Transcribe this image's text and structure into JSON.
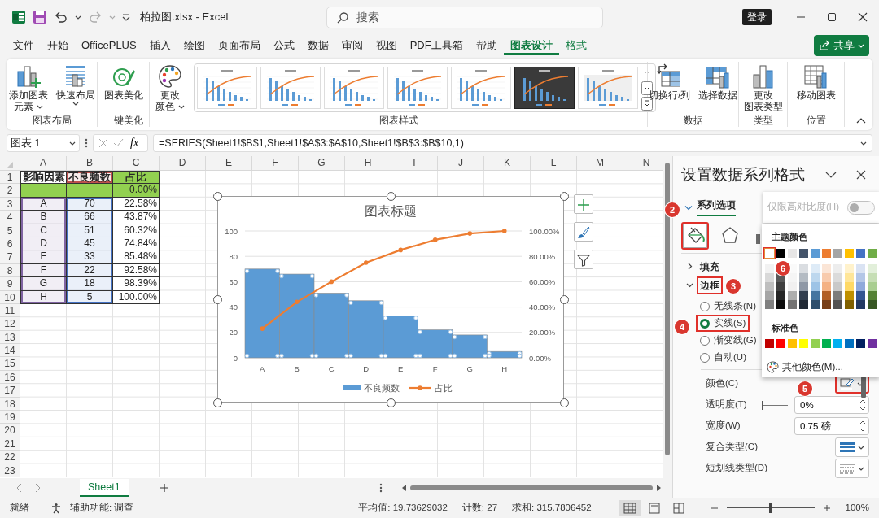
{
  "window": {
    "title": "柏拉图.xlsx  -  Excel"
  },
  "search": {
    "placeholder": "搜索"
  },
  "sign_in": "登录",
  "menu_tabs": [
    {
      "label": "文件",
      "selected": false,
      "kind": "normal"
    },
    {
      "label": "开始",
      "selected": false,
      "kind": "normal"
    },
    {
      "label": "OfficePLUS",
      "selected": false,
      "kind": "normal"
    },
    {
      "label": "插入",
      "selected": false,
      "kind": "normal"
    },
    {
      "label": "绘图",
      "selected": false,
      "kind": "normal"
    },
    {
      "label": "页面布局",
      "selected": false,
      "kind": "normal"
    },
    {
      "label": "公式",
      "selected": false,
      "kind": "normal"
    },
    {
      "label": "数据",
      "selected": false,
      "kind": "normal"
    },
    {
      "label": "审阅",
      "selected": false,
      "kind": "normal"
    },
    {
      "label": "视图",
      "selected": false,
      "kind": "normal"
    },
    {
      "label": "PDF工具箱",
      "selected": false,
      "kind": "normal"
    },
    {
      "label": "帮助",
      "selected": false,
      "kind": "normal"
    },
    {
      "label": "图表设计",
      "selected": true,
      "kind": "contextual"
    },
    {
      "label": "格式",
      "selected": false,
      "kind": "contextual"
    }
  ],
  "share": "共享",
  "ribbon": {
    "groups": [
      {
        "label": "图表布局",
        "commands": [
          {
            "kind": "add-element",
            "lines": [
              "添加图表",
              "元素"
            ],
            "dropdown": true
          },
          {
            "kind": "quick-layout",
            "lines": [
              "快速布局"
            ],
            "dropdown": true
          }
        ]
      },
      {
        "label": "一键美化",
        "commands": [
          {
            "kind": "beautify",
            "lines": [
              "图表美化"
            ],
            "dropdown": false
          }
        ]
      },
      {
        "label": "图表样式",
        "commands": [
          {
            "kind": "colors",
            "lines": [
              "更改",
              "颜色"
            ],
            "dropdown": true
          }
        ],
        "gallery": [
          {
            "kind": "light",
            "selected": false
          },
          {
            "kind": "light",
            "selected": false
          },
          {
            "kind": "light",
            "selected": false
          },
          {
            "kind": "light",
            "selected": false
          },
          {
            "kind": "light",
            "selected": false
          },
          {
            "kind": "dark",
            "selected": false
          },
          {
            "kind": "shaded",
            "selected": false
          }
        ]
      },
      {
        "label": "数据",
        "commands": [
          {
            "kind": "switch",
            "lines": [
              "切换行/列"
            ],
            "dropdown": false
          },
          {
            "kind": "select-data",
            "lines": [
              "选择数据"
            ],
            "dropdown": false
          }
        ]
      },
      {
        "label": "类型",
        "commands": [
          {
            "kind": "chart-type",
            "lines": [
              "更改",
              "图表类型"
            ],
            "dropdown": false
          }
        ]
      },
      {
        "label": "位置",
        "commands": [
          {
            "kind": "move",
            "lines": [
              "移动图表"
            ],
            "dropdown": false
          }
        ]
      }
    ]
  },
  "formula_bar": {
    "name_box": "图表 1",
    "fx": "fx",
    "formula": "=SERIES(Sheet1!$B$1,Sheet1!$A$3:$A$10,Sheet1!$B$3:$B$10,1)"
  },
  "sheet": {
    "columns": [
      "A",
      "B",
      "C",
      "D",
      "E",
      "F",
      "G",
      "H",
      "I",
      "J",
      "K",
      "L",
      "M",
      "N"
    ],
    "rows": [
      "1",
      "2",
      "3",
      "4",
      "5",
      "6",
      "7",
      "8",
      "9",
      "10",
      "11",
      "12",
      "13",
      "14",
      "15",
      "16",
      "17",
      "18",
      "19",
      "20",
      "21",
      "22",
      "23"
    ],
    "cells": [
      [
        {
          "text": "影响因素",
          "kind": "header"
        },
        {
          "text": "不良频数",
          "kind": "header",
          "highlight": {
            "color": "#c0504d"
          }
        },
        {
          "text": "占比",
          "kind": "header",
          "fill": {
            "color": "#92d050"
          }
        }
      ],
      [
        {
          "kind": "data",
          "fill": {
            "color": "#92d050"
          }
        },
        {
          "kind": "data",
          "fill": {
            "color": "#92d050"
          }
        },
        {
          "text": "0.00%",
          "kind": "data",
          "fill": {
            "color": "#92d050"
          }
        }
      ],
      [
        {
          "text": "A",
          "kind": "data",
          "highlight": {
            "color": "#8064a2"
          }
        },
        {
          "text": "70",
          "kind": "data",
          "highlight": {
            "color": "#4472c4"
          }
        },
        {
          "text": "22.58%",
          "kind": "data"
        }
      ],
      [
        {
          "text": "B",
          "kind": "data",
          "highlight": {
            "color": "#8064a2"
          }
        },
        {
          "text": "66",
          "kind": "data",
          "highlight": {
            "color": "#4472c4"
          }
        },
        {
          "text": "43.87%",
          "kind": "data"
        }
      ],
      [
        {
          "text": "C",
          "kind": "data",
          "highlight": {
            "color": "#8064a2"
          }
        },
        {
          "text": "51",
          "kind": "data",
          "highlight": {
            "color": "#4472c4"
          }
        },
        {
          "text": "60.32%",
          "kind": "data"
        }
      ],
      [
        {
          "text": "D",
          "kind": "data",
          "highlight": {
            "color": "#8064a2"
          }
        },
        {
          "text": "45",
          "kind": "data",
          "highlight": {
            "color": "#4472c4"
          }
        },
        {
          "text": "74.84%",
          "kind": "data"
        }
      ],
      [
        {
          "text": "E",
          "kind": "data",
          "highlight": {
            "color": "#8064a2"
          }
        },
        {
          "text": "33",
          "kind": "data",
          "highlight": {
            "color": "#4472c4"
          }
        },
        {
          "text": "85.48%",
          "kind": "data"
        }
      ],
      [
        {
          "text": "F",
          "kind": "data",
          "highlight": {
            "color": "#8064a2"
          }
        },
        {
          "text": "22",
          "kind": "data",
          "highlight": {
            "color": "#4472c4"
          }
        },
        {
          "text": "92.58%",
          "kind": "data"
        }
      ],
      [
        {
          "text": "G",
          "kind": "data",
          "highlight": {
            "color": "#8064a2"
          }
        },
        {
          "text": "18",
          "kind": "data",
          "highlight": {
            "color": "#4472c4"
          }
        },
        {
          "text": "98.39%",
          "kind": "data"
        }
      ],
      [
        {
          "text": "H",
          "kind": "data",
          "highlight": {
            "color": "#8064a2"
          }
        },
        {
          "text": "5",
          "kind": "data",
          "highlight": {
            "color": "#4472c4"
          }
        },
        {
          "text": "100.00%",
          "kind": "data"
        }
      ]
    ]
  },
  "chart": {
    "title": "图表标题",
    "side_buttons": [
      {
        "kind": "add"
      },
      {
        "kind": "style"
      },
      {
        "kind": "filter"
      }
    ],
    "chart_data": {
      "type": "bar",
      "categories": [
        "A",
        "B",
        "C",
        "D",
        "E",
        "F",
        "G",
        "H"
      ],
      "series": [
        {
          "name": "不良频数",
          "color": "#5b9bd5",
          "type": "bar",
          "values": [
            70,
            66,
            51,
            45,
            33,
            22,
            18,
            5
          ]
        },
        {
          "name": "占比",
          "color": "#ed7d31",
          "type": "line",
          "axis": "y2",
          "values": [
            0.23,
            0.44,
            0.6,
            0.75,
            0.85,
            0.93,
            0.98,
            1
          ]
        }
      ],
      "ylim": [
        0,
        100
      ],
      "yticks": [
        0,
        20,
        40,
        60,
        80,
        100
      ],
      "y2lim": [
        0,
        1
      ],
      "y2ticks": [
        {
          "value": 0,
          "label": "0.00%"
        },
        {
          "value": 0.2,
          "label": "20.00%"
        },
        {
          "value": 0.4,
          "label": "40.00%"
        },
        {
          "value": 0.6,
          "label": "60.00%"
        },
        {
          "value": 0.8,
          "label": "80.00%"
        },
        {
          "value": 1,
          "label": "100.00%"
        }
      ],
      "grid": true,
      "legend": true
    }
  },
  "sheet_tabs": [
    {
      "label": "Sheet1",
      "selected": true
    }
  ],
  "format_pane": {
    "title": "设置数据系列格式",
    "section_tab": "系列选项",
    "icon_tabs": [
      {
        "kind": "fill-line",
        "selected": true,
        "highlighted": true
      },
      {
        "kind": "effects",
        "selected": false,
        "highlighted": false
      },
      {
        "kind": "series-options",
        "selected": false,
        "highlighted": false
      }
    ],
    "sections": [
      {
        "label": "填充",
        "expanded": false,
        "highlighted": false
      },
      {
        "label": "边框",
        "expanded": true,
        "highlighted": true
      }
    ],
    "line_options": [
      {
        "label": "无线条(N)",
        "selected": false,
        "highlighted": false
      },
      {
        "label": "实线(S)",
        "selected": true,
        "highlighted": true
      },
      {
        "label": "渐变线(G)",
        "selected": false,
        "highlighted": false
      },
      {
        "label": "自动(U)",
        "selected": false,
        "highlighted": false
      }
    ],
    "properties": [
      {
        "kind": "color",
        "label": "颜色(C)",
        "highlighted": true
      },
      {
        "kind": "slider-spin",
        "label": "透明度(T)",
        "value": "0%",
        "level": 0
      },
      {
        "kind": "spin",
        "label": "宽度(W)",
        "value": "0.75 磅"
      },
      {
        "kind": "compound",
        "label": "复合类型(C)"
      },
      {
        "kind": "dash",
        "label": "短划线类型(D)"
      }
    ]
  },
  "high_contrast": {
    "label": "仅限高对比度(H)",
    "on": false,
    "disabled": true
  },
  "color_picker": {
    "theme_title": "主题颜色",
    "theme_colors": [
      {
        "color": "#ffffff",
        "selected": true,
        "highlighted": true
      },
      {
        "color": "#000000",
        "selected": false,
        "highlighted": false
      },
      {
        "color": "#e7e6e6",
        "selected": false,
        "highlighted": false
      },
      {
        "color": "#44546a",
        "selected": false,
        "highlighted": false
      },
      {
        "color": "#5b9bd5",
        "selected": false,
        "highlighted": false
      },
      {
        "color": "#ed7d31",
        "selected": false,
        "highlighted": false
      },
      {
        "color": "#a5a5a5",
        "selected": false,
        "highlighted": false
      },
      {
        "color": "#ffc000",
        "selected": false,
        "highlighted": false
      },
      {
        "color": "#4472c4",
        "selected": false,
        "highlighted": false
      },
      {
        "color": "#70ad47",
        "selected": false,
        "highlighted": false
      }
    ],
    "standard_title": "标准色",
    "standard_colors": [
      {
        "color": "#c00000",
        "selected": false
      },
      {
        "color": "#ff0000",
        "selected": false
      },
      {
        "color": "#ffc000",
        "selected": false
      },
      {
        "color": "#ffff00",
        "selected": false
      },
      {
        "color": "#92d050",
        "selected": false
      },
      {
        "color": "#00b050",
        "selected": false
      },
      {
        "color": "#00b0f0",
        "selected": false
      },
      {
        "color": "#0070c0",
        "selected": false
      },
      {
        "color": "#002060",
        "selected": false
      },
      {
        "color": "#7030a0",
        "selected": false
      }
    ],
    "more": "其他颜色(M)..."
  },
  "callouts": [
    {
      "number": "2"
    },
    {
      "number": "6"
    },
    {
      "number": "3"
    },
    {
      "number": "4"
    },
    {
      "number": "5"
    }
  ],
  "status_bar": {
    "ready": "就绪",
    "accessibility": "辅助功能: 调查",
    "average": "平均值: 19.73629032",
    "count": "计数: 27",
    "sum": "求和: 315.7806452",
    "views": [
      {
        "kind": "normal",
        "selected": true
      },
      {
        "kind": "page-layout",
        "selected": false
      },
      {
        "kind": "page-break",
        "selected": false
      }
    ],
    "zoom": {
      "level": 0.5,
      "label": "100%"
    }
  }
}
